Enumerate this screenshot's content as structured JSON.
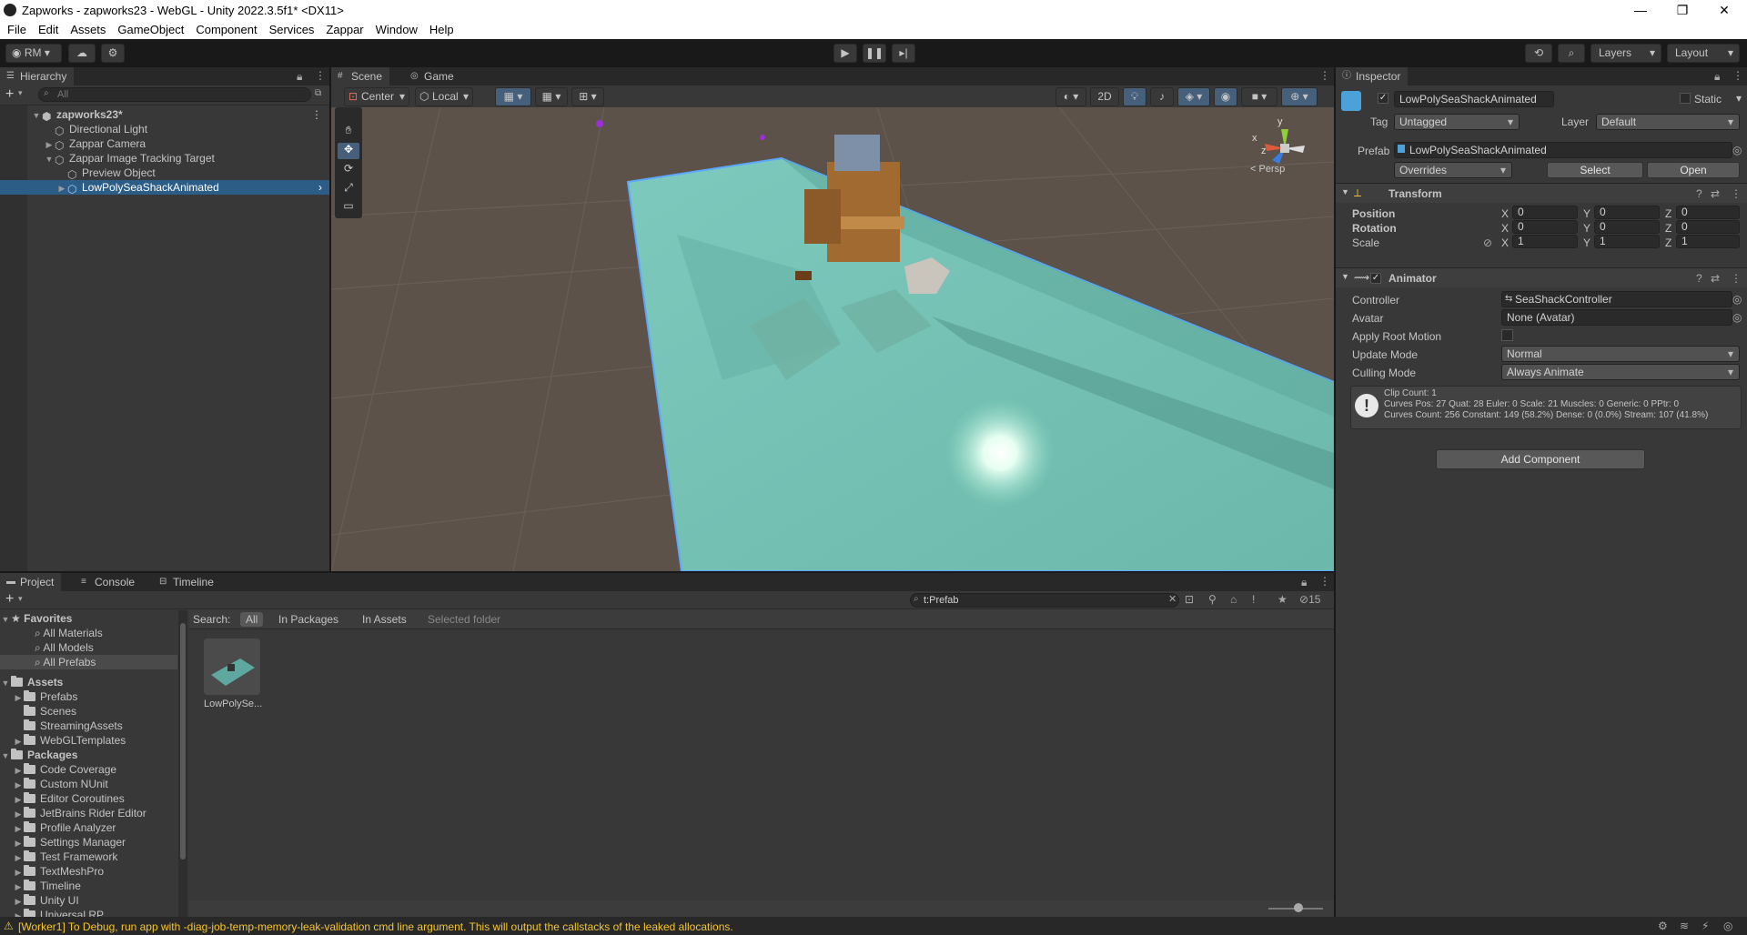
{
  "window": {
    "title": "Zapworks - zapworks23 - WebGL - Unity 2022.3.5f1* <DX11>",
    "controls": [
      "—",
      "❐",
      "✕"
    ]
  },
  "menu": [
    "File",
    "Edit",
    "Assets",
    "GameObject",
    "Component",
    "Services",
    "Zappar",
    "Window",
    "Help"
  ],
  "toolbar": {
    "account": "RM",
    "layers": "Layers",
    "layout": "Layout"
  },
  "hierarchy": {
    "tab": "Hierarchy",
    "search_placeholder": "All",
    "items": [
      {
        "label": "zapworks23*",
        "depth": 0,
        "arrow": "▼",
        "bold": true
      },
      {
        "label": "Directional Light",
        "depth": 1,
        "arrow": ""
      },
      {
        "label": "Zappar Camera",
        "depth": 1,
        "arrow": "▶"
      },
      {
        "label": "Zappar Image Tracking Target",
        "depth": 1,
        "arrow": "▼"
      },
      {
        "label": "Preview Object",
        "depth": 2,
        "arrow": ""
      },
      {
        "label": "LowPolySeaShackAnimated",
        "depth": 2,
        "arrow": "▶",
        "selected": true
      }
    ]
  },
  "scene": {
    "tabs": [
      "Scene",
      "Game"
    ],
    "pivot": "Center",
    "space": "Local",
    "mode2d": "2D",
    "persp": "< Persp",
    "gizmo_axes": {
      "x": "x",
      "y": "y",
      "z": "z"
    }
  },
  "inspector": {
    "tab": "Inspector",
    "object_name": "LowPolySeaShackAnimated",
    "static_label": "Static",
    "tag_label": "Tag",
    "tag_value": "Untagged",
    "layer_label": "Layer",
    "layer_value": "Default",
    "prefab_label": "Prefab",
    "prefab_value": "LowPolySeaShackAnimated",
    "overrides": "Overrides",
    "select": "Select",
    "open": "Open",
    "transform": {
      "title": "Transform",
      "rows": [
        {
          "label": "Position",
          "x": "0",
          "y": "0",
          "z": "0"
        },
        {
          "label": "Rotation",
          "x": "0",
          "y": "0",
          "z": "0"
        },
        {
          "label": "Scale",
          "x": "1",
          "y": "1",
          "z": "1"
        }
      ],
      "axes": [
        "X",
        "Y",
        "Z"
      ]
    },
    "animator": {
      "title": "Animator",
      "controller_label": "Controller",
      "controller_value": "SeaShackController",
      "avatar_label": "Avatar",
      "avatar_value": "None (Avatar)",
      "root_motion_label": "Apply Root Motion",
      "update_mode_label": "Update Mode",
      "update_mode_value": "Normal",
      "culling_mode_label": "Culling Mode",
      "culling_mode_value": "Always Animate",
      "info": [
        "Clip Count: 1",
        "Curves Pos: 27 Quat: 28 Euler: 0 Scale: 21 Muscles: 0 Generic: 0 PPtr: 0",
        "Curves Count: 256 Constant: 149 (58.2%) Dense: 0 (0.0%) Stream: 107 (41.8%)"
      ]
    },
    "add_component": "Add Component"
  },
  "project": {
    "tabs": [
      "Project",
      "Console",
      "Timeline"
    ],
    "search_value": "t:Prefab",
    "hidden_count": "15",
    "search_label": "Search:",
    "scopes": [
      "All",
      "In Packages",
      "In Assets",
      "Selected folder"
    ],
    "favorites_label": "Favorites",
    "favorites": [
      "All Materials",
      "All Models",
      "All Prefabs"
    ],
    "assets_label": "Assets",
    "assets": [
      {
        "label": "Prefabs",
        "arrow": "▶"
      },
      {
        "label": "Scenes",
        "arrow": ""
      },
      {
        "label": "StreamingAssets",
        "arrow": ""
      },
      {
        "label": "WebGLTemplates",
        "arrow": "▶"
      }
    ],
    "packages_label": "Packages",
    "packages": [
      "Code Coverage",
      "Custom NUnit",
      "Editor Coroutines",
      "JetBrains Rider Editor",
      "Profile Analyzer",
      "Settings Manager",
      "Test Framework",
      "TextMeshPro",
      "Timeline",
      "Unity UI",
      "Universal RP"
    ],
    "result_label": "LowPolySe..."
  },
  "status": {
    "message": "[Worker1] To Debug, run app with -diag-job-temp-memory-leak-validation cmd line argument. This will output the callstacks of the leaked allocations."
  },
  "colors": {
    "accent": "#2c5d87",
    "water": "#7fd3c6",
    "warning": "#f4c430"
  }
}
